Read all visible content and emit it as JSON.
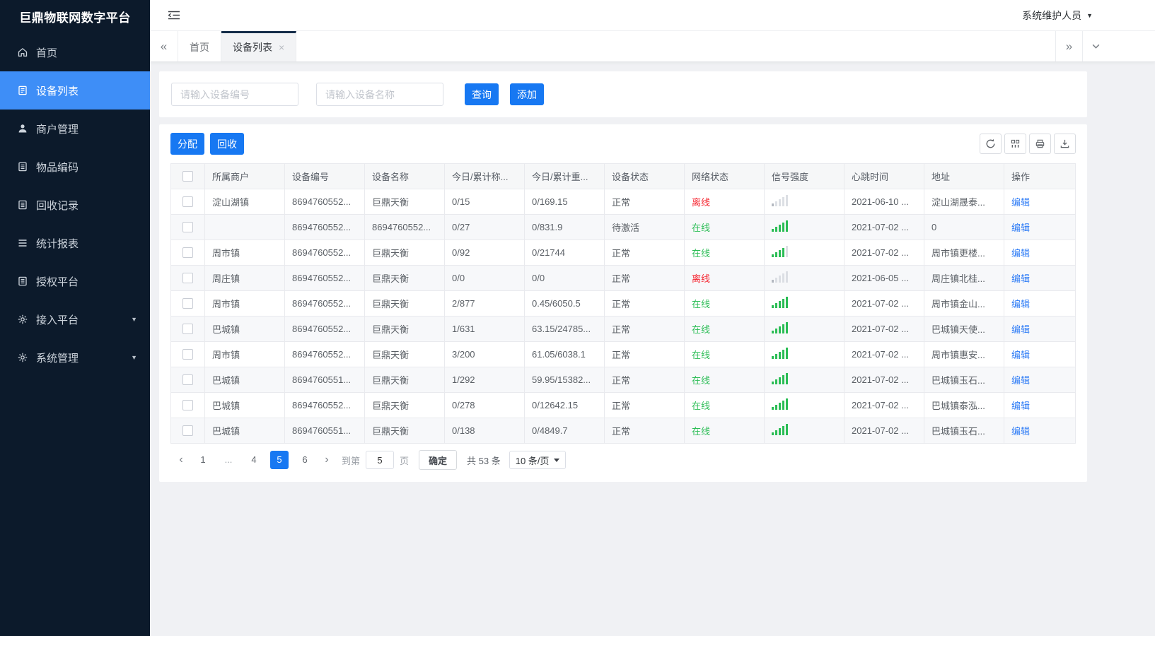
{
  "colors": {
    "accent": "#1778f2",
    "sidebar_bg": "#0c1a2b",
    "sidebar_active": "#3e8ef7",
    "online_green": "#2bbd55",
    "offline_red": "#f5222d",
    "link_blue": "#2e7cf6",
    "tab_active_border": "#142c49"
  },
  "icons": {
    "caret_down": "▼",
    "close": "×",
    "scroll_left": "«",
    "scroll_right": "»",
    "prev": "‹",
    "next": "›"
  },
  "sidebar": {
    "title": "巨鼎物联网数字平台",
    "items": [
      {
        "key": "home",
        "label": "首页",
        "icon": "home-icon",
        "active": false,
        "expandable": false
      },
      {
        "key": "device-list",
        "label": "设备列表",
        "icon": "list-icon",
        "active": true,
        "expandable": false
      },
      {
        "key": "merchant-mgmt",
        "label": "商户管理",
        "icon": "user-icon",
        "active": false,
        "expandable": false
      },
      {
        "key": "item-code",
        "label": "物品编码",
        "icon": "doc-icon",
        "active": false,
        "expandable": false
      },
      {
        "key": "recycle-record",
        "label": "回收记录",
        "icon": "doc-icon",
        "active": false,
        "expandable": false
      },
      {
        "key": "stats-report",
        "label": "统计报表",
        "icon": "lines-icon",
        "active": false,
        "expandable": false
      },
      {
        "key": "auth-platform",
        "label": "授权平台",
        "icon": "doc-icon",
        "active": false,
        "expandable": false
      },
      {
        "key": "access-platform",
        "label": "接入平台",
        "icon": "gear-icon",
        "active": false,
        "expandable": true
      },
      {
        "key": "system-mgmt",
        "label": "系统管理",
        "icon": "gear-icon",
        "active": false,
        "expandable": true
      }
    ]
  },
  "topbar": {
    "user": "系统维护人员"
  },
  "tabbar": {
    "tabs": [
      {
        "label": "首页",
        "active": false,
        "closable": false
      },
      {
        "label": "设备列表",
        "active": true,
        "closable": true
      }
    ]
  },
  "search": {
    "device_no_placeholder": "请输入设备编号",
    "device_name_placeholder": "请输入设备名称",
    "query_label": "查询",
    "add_label": "添加"
  },
  "toolbar": {
    "assign_label": "分配",
    "recycle_label": "回收"
  },
  "table": {
    "columns": [
      "所属商户",
      "设备编号",
      "设备名称",
      "今日/累计称...",
      "今日/累计重...",
      "设备状态",
      "网络状态",
      "信号强度",
      "心跳时间",
      "地址",
      "操作"
    ],
    "edit_label": "编辑",
    "rows": [
      {
        "merchant": "淀山湖镇",
        "device_no": "8694760552...",
        "device_name": "巨鼎天衡",
        "today_count": "0/15",
        "today_weight": "0/169.15",
        "device_status": "正常",
        "network": "离线",
        "network_online": false,
        "signal_level": 1,
        "heartbeat": "2021-06-10 ...",
        "address": "淀山湖晟泰..."
      },
      {
        "merchant": "",
        "device_no": "8694760552...",
        "device_name": "8694760552...",
        "today_count": "0/27",
        "today_weight": "0/831.9",
        "device_status": "待激活",
        "network": "在线",
        "network_online": true,
        "signal_level": 5,
        "heartbeat": "2021-07-02 ...",
        "address": "0"
      },
      {
        "merchant": "周市镇",
        "device_no": "8694760552...",
        "device_name": "巨鼎天衡",
        "today_count": "0/92",
        "today_weight": "0/21744",
        "device_status": "正常",
        "network": "在线",
        "network_online": true,
        "signal_level": 4,
        "heartbeat": "2021-07-02 ...",
        "address": "周市镇更楼..."
      },
      {
        "merchant": "周庄镇",
        "device_no": "8694760552...",
        "device_name": "巨鼎天衡",
        "today_count": "0/0",
        "today_weight": "0/0",
        "device_status": "正常",
        "network": "离线",
        "network_online": false,
        "signal_level": 1,
        "heartbeat": "2021-06-05 ...",
        "address": "周庄镇北桂..."
      },
      {
        "merchant": "周市镇",
        "device_no": "8694760552...",
        "device_name": "巨鼎天衡",
        "today_count": "2/877",
        "today_weight": "0.45/6050.5",
        "device_status": "正常",
        "network": "在线",
        "network_online": true,
        "signal_level": 5,
        "heartbeat": "2021-07-02 ...",
        "address": "周市镇金山..."
      },
      {
        "merchant": "巴城镇",
        "device_no": "8694760552...",
        "device_name": "巨鼎天衡",
        "today_count": "1/631",
        "today_weight": "63.15/24785...",
        "device_status": "正常",
        "network": "在线",
        "network_online": true,
        "signal_level": 5,
        "heartbeat": "2021-07-02 ...",
        "address": "巴城镇天使..."
      },
      {
        "merchant": "周市镇",
        "device_no": "8694760552...",
        "device_name": "巨鼎天衡",
        "today_count": "3/200",
        "today_weight": "61.05/6038.1",
        "device_status": "正常",
        "network": "在线",
        "network_online": true,
        "signal_level": 5,
        "heartbeat": "2021-07-02 ...",
        "address": "周市镇惠安..."
      },
      {
        "merchant": "巴城镇",
        "device_no": "8694760551...",
        "device_name": "巨鼎天衡",
        "today_count": "1/292",
        "today_weight": "59.95/15382...",
        "device_status": "正常",
        "network": "在线",
        "network_online": true,
        "signal_level": 5,
        "heartbeat": "2021-07-02 ...",
        "address": "巴城镇玉石..."
      },
      {
        "merchant": "巴城镇",
        "device_no": "8694760552...",
        "device_name": "巨鼎天衡",
        "today_count": "0/278",
        "today_weight": "0/12642.15",
        "device_status": "正常",
        "network": "在线",
        "network_online": true,
        "signal_level": 5,
        "heartbeat": "2021-07-02 ...",
        "address": "巴城镇泰泓..."
      },
      {
        "merchant": "巴城镇",
        "device_no": "8694760551...",
        "device_name": "巨鼎天衡",
        "today_count": "0/138",
        "today_weight": "0/4849.7",
        "device_status": "正常",
        "network": "在线",
        "network_online": true,
        "signal_level": 5,
        "heartbeat": "2021-07-02 ...",
        "address": "巴城镇玉石..."
      }
    ]
  },
  "pagination": {
    "pages": [
      {
        "label": "1",
        "active": false
      },
      {
        "label": "...",
        "active": false
      },
      {
        "label": "4",
        "active": false
      },
      {
        "label": "5",
        "active": true
      },
      {
        "label": "6",
        "active": false
      }
    ],
    "goto_label": "到第",
    "goto_value": "5",
    "page_unit_label": "页",
    "confirm_label": "确定",
    "total_label": "共 53 条",
    "page_size_label": "10 条/页"
  }
}
